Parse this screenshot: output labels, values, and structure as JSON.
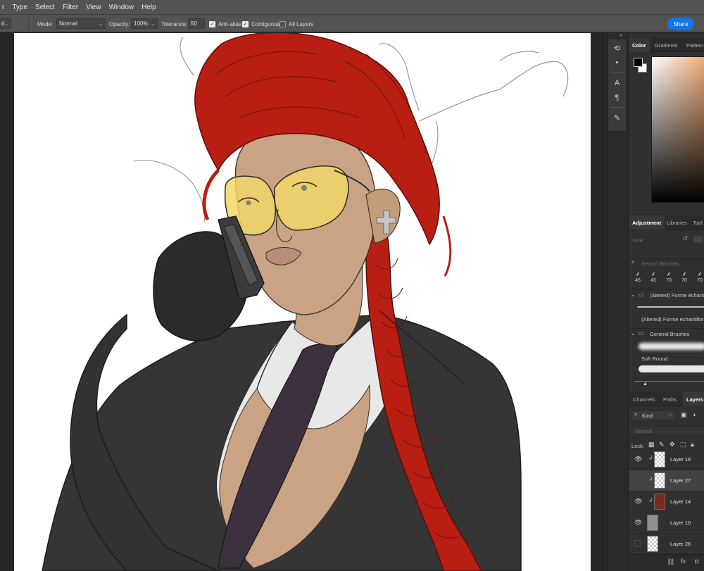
{
  "menu": [
    "r",
    "Type",
    "Select",
    "Filter",
    "View",
    "Window",
    "Help"
  ],
  "options_bar": {
    "tool_fragment": "d",
    "mode_label": "Mode:",
    "mode_value": "Normal",
    "opacity_label": "Opacity:",
    "opacity_value": "100%",
    "tolerance_label": "Tolerance:",
    "tolerance_value": "50",
    "anti_alias": {
      "label": "Anti-alias",
      "checked": true
    },
    "contiguous": {
      "label": "Contiguous",
      "checked": true
    },
    "all_layers": {
      "label": "All Layers",
      "checked": false
    },
    "share_label": "Share"
  },
  "color_panel": {
    "tabs": [
      "Color",
      "Gradients",
      "Pattern"
    ],
    "active_tab": "Color",
    "foreground": "#000000",
    "background": "#ffffff"
  },
  "brush_panel": {
    "tabs": [
      "Adjustment",
      "Libraries",
      "Tool"
    ],
    "size_label": "Size:",
    "search_placeholder": "Search Brushes",
    "preset_sizes": [
      "45",
      "45",
      "70",
      "70",
      "70"
    ],
    "groups": [
      {
        "name": "(Altered) Forme échantil",
        "brush": "(Altered) Forme échantillon"
      },
      {
        "name": "General Brushes",
        "brush": "Soft Round"
      }
    ]
  },
  "layers_panel": {
    "tabs": [
      "Channels",
      "Paths",
      "Layers"
    ],
    "active_tab": "Layers",
    "filter_label": "Kind",
    "blend_mode": "Normal",
    "lock_label": "Lock:",
    "layers": [
      {
        "name": "Layer 18",
        "visible": true,
        "clipped": true,
        "selected": false
      },
      {
        "name": "Layer 27",
        "visible": false,
        "clipped": true,
        "selected": true
      },
      {
        "name": "Layer 14",
        "visible": true,
        "clipped": true,
        "selected": false
      },
      {
        "name": "Layer 10",
        "visible": true,
        "clipped": false,
        "selected": false
      },
      {
        "name": "Layer 26",
        "visible": false,
        "clipped": false,
        "selected": false
      }
    ]
  },
  "accent": "#1473e6"
}
